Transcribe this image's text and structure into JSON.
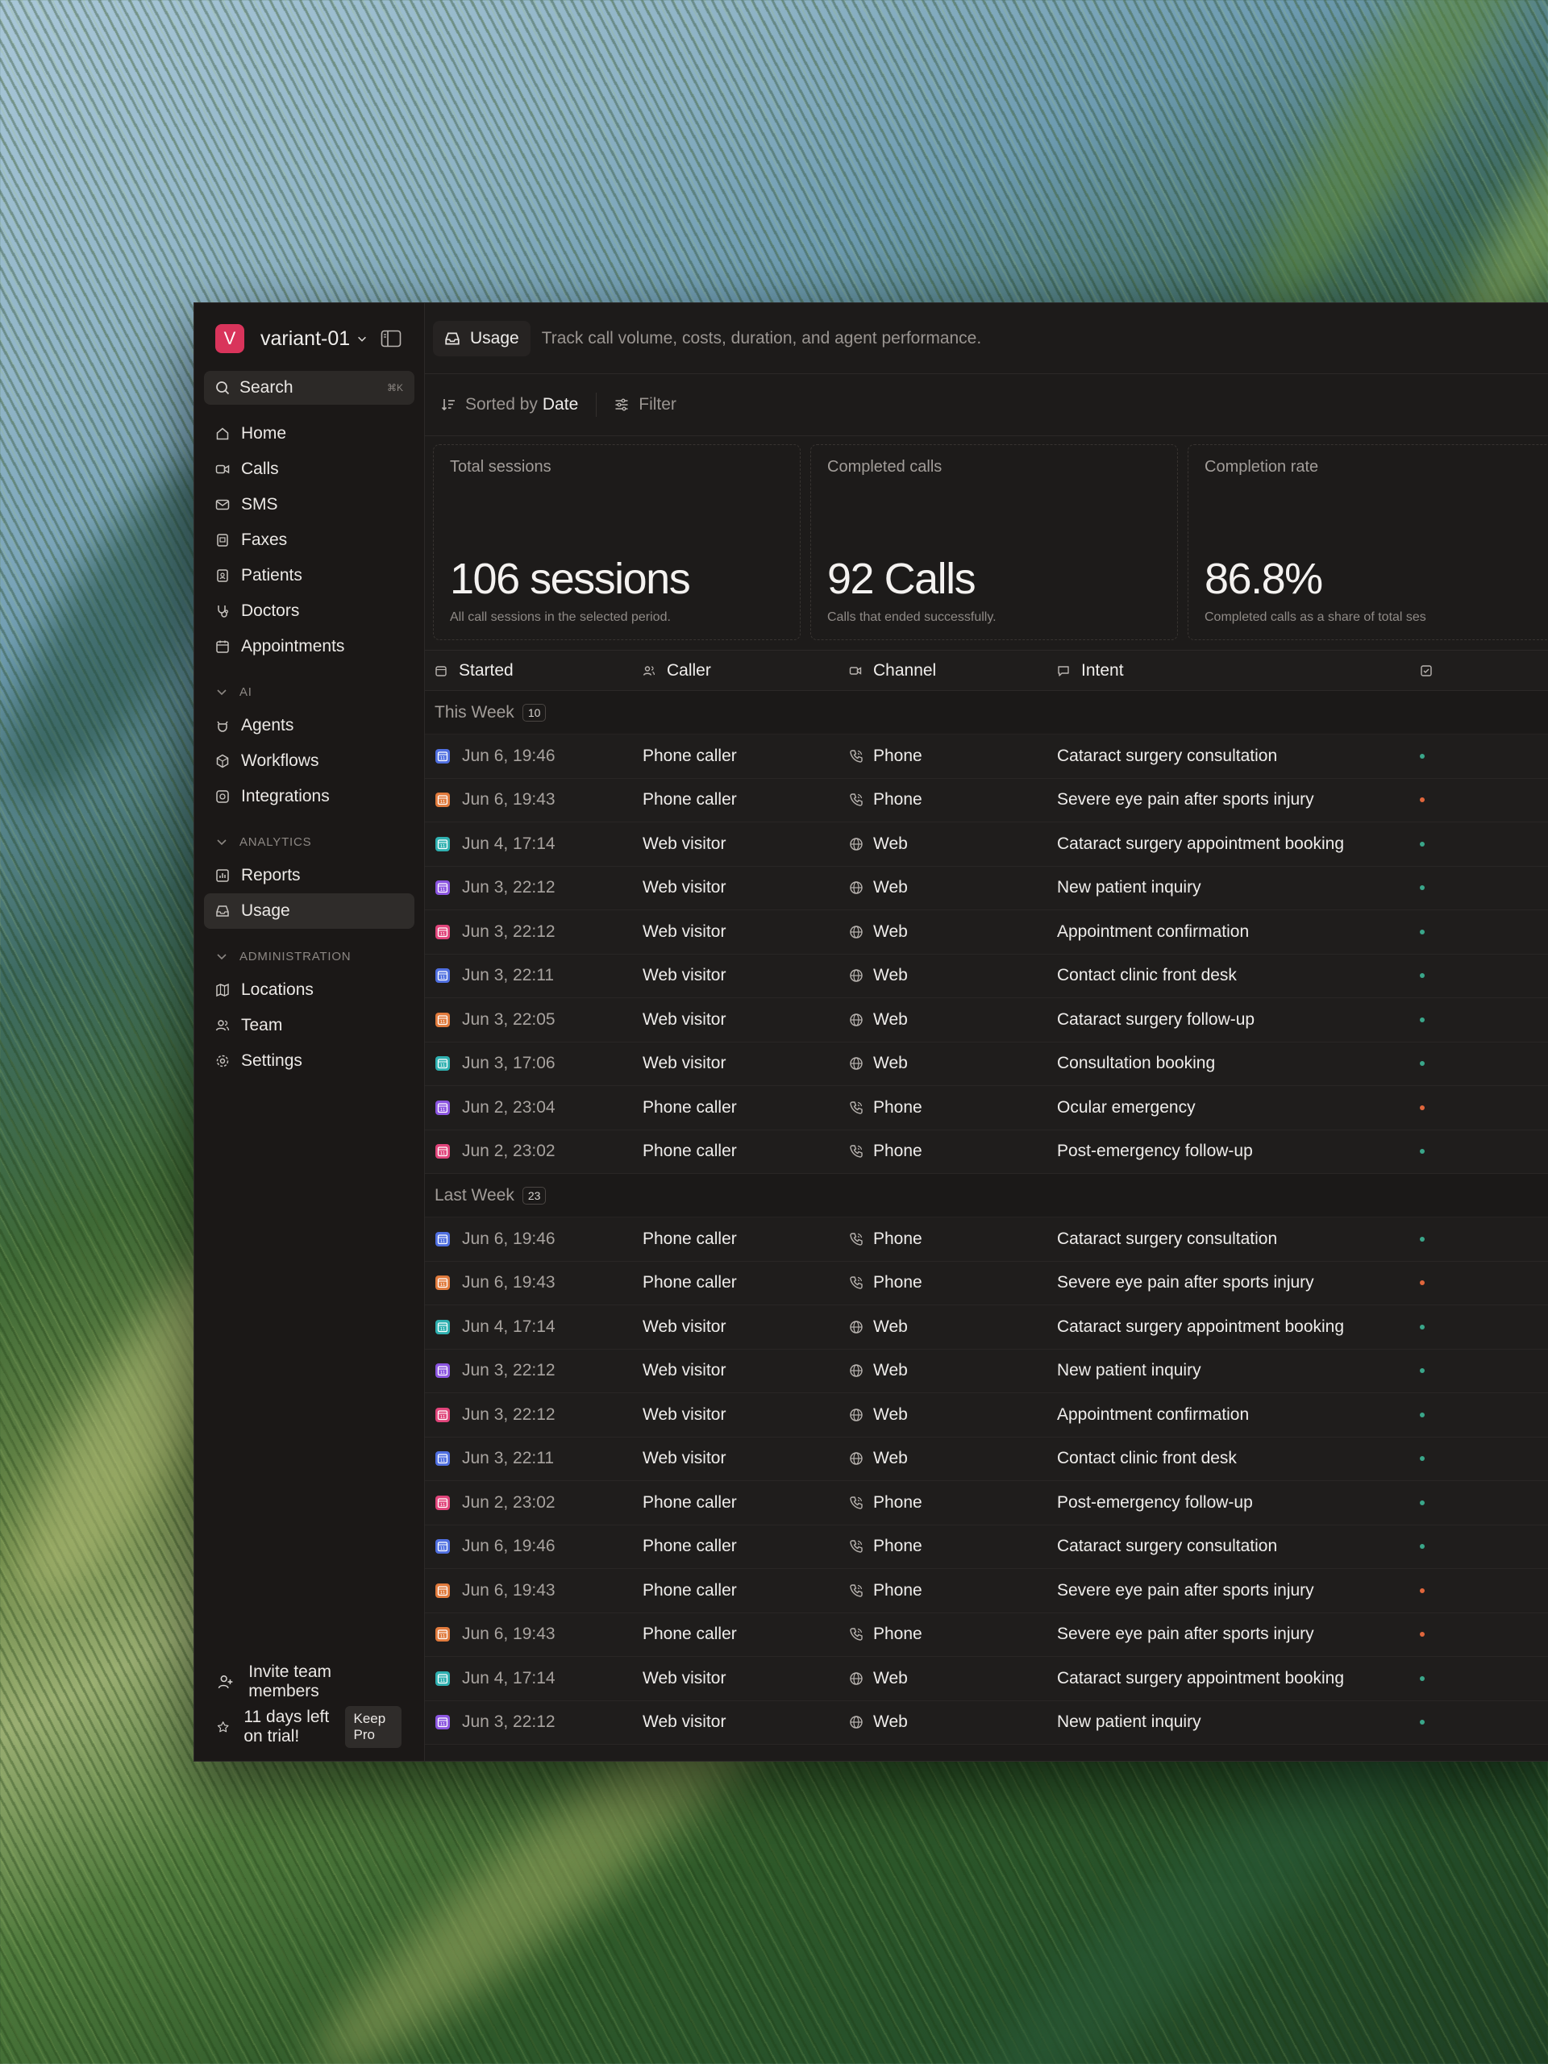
{
  "colors": {
    "brand": "#d9345b",
    "cal_blue": "#4f6fe0",
    "cal_orange": "#e07a3c",
    "cal_teal": "#2fb0b0",
    "cal_purple": "#8b55e0",
    "cal_pink": "#e0447a",
    "status_green": "#3aa68a",
    "status_orange": "#e0663c"
  },
  "workspace": {
    "initial": "V",
    "name": "variant-01"
  },
  "search": {
    "label": "Search",
    "shortcut": "⌘K"
  },
  "sidebar": {
    "main_items": [
      {
        "label": "Home",
        "icon": "home-icon"
      },
      {
        "label": "Calls",
        "icon": "video-icon"
      },
      {
        "label": "SMS",
        "icon": "mail-icon"
      },
      {
        "label": "Faxes",
        "icon": "fax-icon"
      },
      {
        "label": "Patients",
        "icon": "patients-icon"
      },
      {
        "label": "Doctors",
        "icon": "stethoscope-icon"
      },
      {
        "label": "Appointments",
        "icon": "calendar-icon"
      }
    ],
    "ai": {
      "title": "AI",
      "items": [
        {
          "label": "Agents",
          "icon": "agent-icon"
        },
        {
          "label": "Workflows",
          "icon": "workflow-icon"
        },
        {
          "label": "Integrations",
          "icon": "integrations-icon"
        }
      ]
    },
    "analytics": {
      "title": "ANALYTICS",
      "items": [
        {
          "label": "Reports",
          "icon": "reports-icon"
        },
        {
          "label": "Usage",
          "icon": "inbox-icon"
        }
      ]
    },
    "administration": {
      "title": "ADMINISTRATION",
      "items": [
        {
          "label": "Locations",
          "icon": "map-icon"
        },
        {
          "label": "Team",
          "icon": "team-icon"
        },
        {
          "label": "Settings",
          "icon": "gear-icon"
        }
      ]
    },
    "footer": {
      "invite": "Invite team members",
      "trial": "11 days left on trial!",
      "keep_pro": "Keep Pro"
    }
  },
  "header": {
    "page_title": "Usage",
    "description": "Track call volume, costs, duration, and agent performance."
  },
  "toolbar": {
    "sorted_prefix": "Sorted by",
    "sorted_field": "Date",
    "filter": "Filter"
  },
  "stats": [
    {
      "title": "Total sessions",
      "value": "106 sessions",
      "sub": "All call sessions in the selected period."
    },
    {
      "title": "Completed calls",
      "value": "92 Calls",
      "sub": "Calls that ended successfully."
    },
    {
      "title": "Completion rate",
      "value": "86.8%",
      "sub": "Completed calls as a share of total ses"
    }
  ],
  "table": {
    "columns": {
      "started": "Started",
      "caller": "Caller",
      "channel": "Channel",
      "intent": "Intent"
    },
    "groups": [
      {
        "title": "This Week",
        "count": "10",
        "rows": [
          {
            "started": "Jun 6, 19:46",
            "caller": "Phone caller",
            "channel": "Phone",
            "intent": "Cataract surgery consultation",
            "cal": "blue",
            "status": "green"
          },
          {
            "started": "Jun 6, 19:43",
            "caller": "Phone caller",
            "channel": "Phone",
            "intent": "Severe eye pain after sports injury",
            "cal": "orange",
            "status": "orange"
          },
          {
            "started": "Jun 4, 17:14",
            "caller": "Web visitor",
            "channel": "Web",
            "intent": "Cataract surgery appointment booking",
            "cal": "teal",
            "status": "green"
          },
          {
            "started": "Jun 3, 22:12",
            "caller": "Web visitor",
            "channel": "Web",
            "intent": "New patient inquiry",
            "cal": "purple",
            "status": "green"
          },
          {
            "started": "Jun 3, 22:12",
            "caller": "Web visitor",
            "channel": "Web",
            "intent": "Appointment confirmation",
            "cal": "pink",
            "status": "green"
          },
          {
            "started": "Jun 3, 22:11",
            "caller": "Web visitor",
            "channel": "Web",
            "intent": "Contact clinic front desk",
            "cal": "blue",
            "status": "green"
          },
          {
            "started": "Jun 3, 22:05",
            "caller": "Web visitor",
            "channel": "Web",
            "intent": "Cataract surgery follow-up",
            "cal": "orange",
            "status": "green"
          },
          {
            "started": "Jun 3, 17:06",
            "caller": "Web visitor",
            "channel": "Web",
            "intent": "Consultation booking",
            "cal": "teal",
            "status": "green"
          },
          {
            "started": "Jun 2, 23:04",
            "caller": "Phone caller",
            "channel": "Phone",
            "intent": "Ocular emergency",
            "cal": "purple",
            "status": "orange"
          },
          {
            "started": "Jun 2, 23:02",
            "caller": "Phone caller",
            "channel": "Phone",
            "intent": "Post-emergency follow-up",
            "cal": "pink",
            "status": "green"
          }
        ]
      },
      {
        "title": "Last Week",
        "count": "23",
        "rows": [
          {
            "started": "Jun 6, 19:46",
            "caller": "Phone caller",
            "channel": "Phone",
            "intent": "Cataract surgery consultation",
            "cal": "blue",
            "status": "green"
          },
          {
            "started": "Jun 6, 19:43",
            "caller": "Phone caller",
            "channel": "Phone",
            "intent": "Severe eye pain after sports injury",
            "cal": "orange",
            "status": "orange"
          },
          {
            "started": "Jun 4, 17:14",
            "caller": "Web visitor",
            "channel": "Web",
            "intent": "Cataract surgery appointment booking",
            "cal": "teal",
            "status": "green"
          },
          {
            "started": "Jun 3, 22:12",
            "caller": "Web visitor",
            "channel": "Web",
            "intent": "New patient inquiry",
            "cal": "purple",
            "status": "green"
          },
          {
            "started": "Jun 3, 22:12",
            "caller": "Web visitor",
            "channel": "Web",
            "intent": "Appointment confirmation",
            "cal": "pink",
            "status": "green"
          },
          {
            "started": "Jun 3, 22:11",
            "caller": "Web visitor",
            "channel": "Web",
            "intent": "Contact clinic front desk",
            "cal": "blue",
            "status": "green"
          },
          {
            "started": "Jun 2, 23:02",
            "caller": "Phone caller",
            "channel": "Phone",
            "intent": "Post-emergency follow-up",
            "cal": "pink",
            "status": "green"
          },
          {
            "started": "Jun 6, 19:46",
            "caller": "Phone caller",
            "channel": "Phone",
            "intent": "Cataract surgery consultation",
            "cal": "blue",
            "status": "green"
          },
          {
            "started": "Jun 6, 19:43",
            "caller": "Phone caller",
            "channel": "Phone",
            "intent": "Severe eye pain after sports injury",
            "cal": "orange",
            "status": "orange"
          },
          {
            "started": "Jun 6, 19:43",
            "caller": "Phone caller",
            "channel": "Phone",
            "intent": "Severe eye pain after sports injury",
            "cal": "orange",
            "status": "orange"
          },
          {
            "started": "Jun 4, 17:14",
            "caller": "Web visitor",
            "channel": "Web",
            "intent": "Cataract surgery appointment booking",
            "cal": "teal",
            "status": "green"
          },
          {
            "started": "Jun 3, 22:12",
            "caller": "Web visitor",
            "channel": "Web",
            "intent": "New patient inquiry",
            "cal": "purple",
            "status": "green"
          }
        ]
      }
    ]
  }
}
